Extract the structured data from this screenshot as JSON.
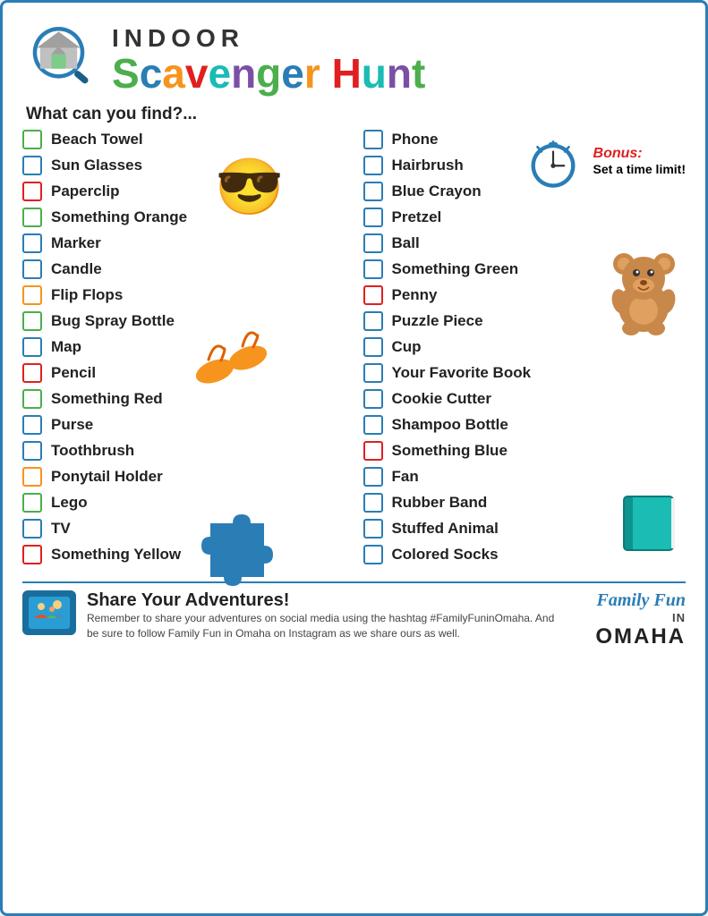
{
  "header": {
    "indoor_label": "INDOOR",
    "scavenger": "Scavenger",
    "hunt": "Hunt"
  },
  "subtitle": "What can you find?...",
  "bonus": {
    "label": "Bonus:",
    "text": "Set a time limit!"
  },
  "col_left": [
    {
      "label": "Beach Towel",
      "color": "cb-green"
    },
    {
      "label": "Sun Glasses",
      "color": "cb-blue"
    },
    {
      "label": "Paperclip",
      "color": "cb-red"
    },
    {
      "label": "Something Orange",
      "color": "cb-green"
    },
    {
      "label": "Marker",
      "color": "cb-blue"
    },
    {
      "label": "Candle",
      "color": "cb-blue"
    },
    {
      "label": "Flip Flops",
      "color": "cb-orange"
    },
    {
      "label": "Bug Spray Bottle",
      "color": "cb-green"
    },
    {
      "label": "Map",
      "color": "cb-blue"
    },
    {
      "label": "Pencil",
      "color": "cb-red"
    },
    {
      "label": "Something Red",
      "color": "cb-green"
    },
    {
      "label": "Purse",
      "color": "cb-blue"
    },
    {
      "label": "Toothbrush",
      "color": "cb-blue"
    },
    {
      "label": "Ponytail Holder",
      "color": "cb-orange"
    },
    {
      "label": "Lego",
      "color": "cb-green"
    },
    {
      "label": "TV",
      "color": "cb-blue"
    },
    {
      "label": "Something Yellow",
      "color": "cb-red"
    }
  ],
  "col_right": [
    {
      "label": "Phone",
      "color": "cb-blue"
    },
    {
      "label": "Hairbrush",
      "color": "cb-blue"
    },
    {
      "label": "Blue Crayon",
      "color": "cb-blue"
    },
    {
      "label": "Pretzel",
      "color": "cb-blue"
    },
    {
      "label": "Ball",
      "color": "cb-blue"
    },
    {
      "label": "Something Green",
      "color": "cb-blue"
    },
    {
      "label": "Penny",
      "color": "cb-red"
    },
    {
      "label": "Puzzle Piece",
      "color": "cb-blue"
    },
    {
      "label": "Cup",
      "color": "cb-blue"
    },
    {
      "label": "Your Favorite Book",
      "color": "cb-blue"
    },
    {
      "label": "Cookie Cutter",
      "color": "cb-blue"
    },
    {
      "label": "Shampoo Bottle",
      "color": "cb-blue"
    },
    {
      "label": "Something Blue",
      "color": "cb-red"
    },
    {
      "label": "Fan",
      "color": "cb-blue"
    },
    {
      "label": "Rubber Band",
      "color": "cb-blue"
    },
    {
      "label": "Stuffed Animal",
      "color": "cb-blue"
    },
    {
      "label": "Colored Socks",
      "color": "cb-blue"
    }
  ],
  "footer": {
    "share_title": "Share Your Adventures!",
    "share_body": "Remember to share your adventures on social media using the hashtag #FamilyFuninOmaha. And be sure to follow Family Fun in Omaha on Instagram as we share ours as well.",
    "brand_family": "Family Fun",
    "brand_in": "IN",
    "brand_omaha": "OMAHA"
  }
}
